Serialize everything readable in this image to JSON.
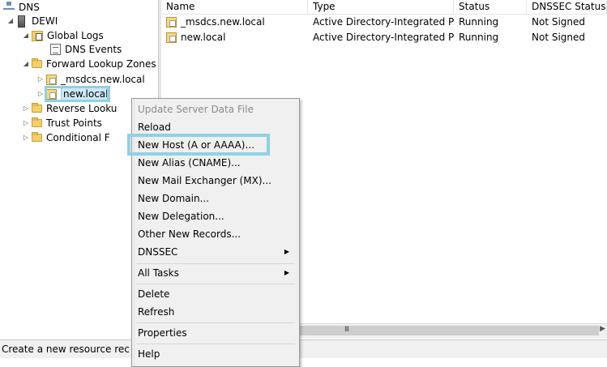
{
  "tree": {
    "root": "DNS",
    "server": "DEWI",
    "global_logs": "Global Logs",
    "dns_events": "DNS Events",
    "forward_zones": "Forward Lookup Zones",
    "msdcs_zone": "_msdcs.new.local",
    "new_local": "new.local",
    "reverse_zones": "Reverse Looku",
    "trust_points": "Trust Points",
    "conditional": "Conditional F"
  },
  "list": {
    "columns": [
      "Name",
      "Type",
      "Status",
      "DNSSEC Status"
    ],
    "rows": [
      {
        "name": "_msdcs.new.local",
        "type": "Active Directory-Integrated Pr...",
        "status": "Running",
        "dnssec": "Not Signed"
      },
      {
        "name": "new.local",
        "type": "Active Directory-Integrated Pr...",
        "status": "Running",
        "dnssec": "Not Signed"
      }
    ],
    "hscroll_grip": "III"
  },
  "menu": {
    "update": "Update Server Data File",
    "reload": "Reload",
    "new_host": "New Host (A or AAAA)...",
    "new_alias": "New Alias (CNAME)...",
    "new_mx": "New Mail Exchanger (MX)...",
    "new_domain": "New Domain...",
    "new_delegation": "New Delegation...",
    "other_records": "Other New Records...",
    "dnssec": "DNSSEC",
    "all_tasks": "All Tasks",
    "delete": "Delete",
    "refresh": "Refresh",
    "properties": "Properties",
    "help": "Help",
    "submenu_arrow": "▶"
  },
  "status": {
    "text": "Create a new resource rec"
  },
  "icons": {
    "expanded": "◢",
    "collapsed": "▷"
  }
}
